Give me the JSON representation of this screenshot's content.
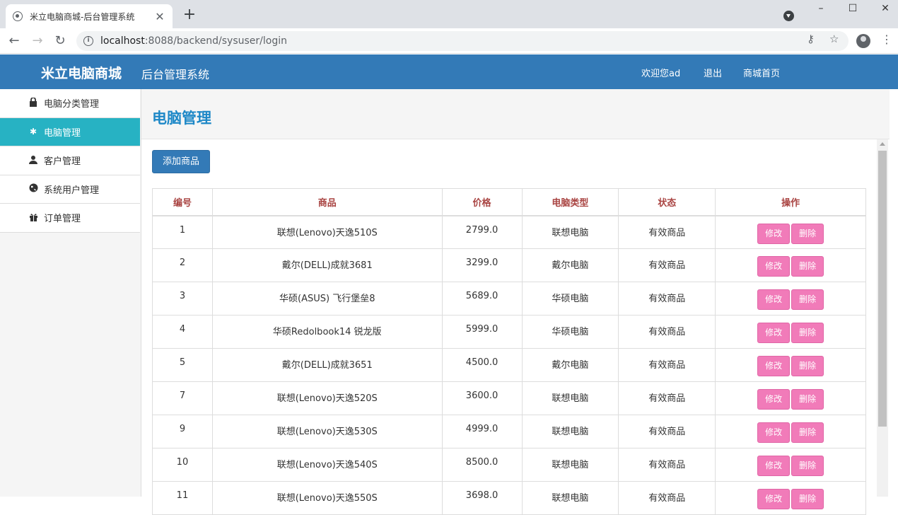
{
  "browser": {
    "tab_title": "米立电脑商城-后台管理系统",
    "url_host": "localhost",
    "url_path": ":8088/backend/sysuser/login"
  },
  "header": {
    "brand": "米立电脑商城",
    "subtitle": "后台管理系统",
    "welcome": "欢迎您ad",
    "logout": "退出",
    "home": "商城首页"
  },
  "sidebar": {
    "items": [
      {
        "label": "电脑分类管理",
        "icon": "lock-icon"
      },
      {
        "label": "电脑管理",
        "icon": "asterisk-icon",
        "active": true
      },
      {
        "label": "客户管理",
        "icon": "user-icon"
      },
      {
        "label": "系统用户管理",
        "icon": "globe-icon"
      },
      {
        "label": "订单管理",
        "icon": "gift-icon"
      }
    ]
  },
  "main": {
    "title": "电脑管理",
    "add_button": "添加商品"
  },
  "table": {
    "columns": [
      "编号",
      "商品",
      "价格",
      "电脑类型",
      "状态",
      "操作"
    ],
    "edit_label": "修改",
    "delete_label": "删除",
    "rows": [
      {
        "id": "1",
        "name": "联想(Lenovo)天逸510S",
        "price": "2799.0",
        "type": "联想电脑",
        "status": "有效商品"
      },
      {
        "id": "2",
        "name": "戴尔(DELL)成就3681",
        "price": "3299.0",
        "type": "戴尔电脑",
        "status": "有效商品"
      },
      {
        "id": "3",
        "name": "华硕(ASUS) 飞行堡垒8",
        "price": "5689.0",
        "type": "华硕电脑",
        "status": "有效商品"
      },
      {
        "id": "4",
        "name": "华硕Redolbook14 锐龙版",
        "price": "5999.0",
        "type": "华硕电脑",
        "status": "有效商品"
      },
      {
        "id": "5",
        "name": "戴尔(DELL)成就3651",
        "price": "4500.0",
        "type": "戴尔电脑",
        "status": "有效商品"
      },
      {
        "id": "7",
        "name": "联想(Lenovo)天逸520S",
        "price": "3600.0",
        "type": "联想电脑",
        "status": "有效商品"
      },
      {
        "id": "9",
        "name": "联想(Lenovo)天逸530S",
        "price": "4999.0",
        "type": "联想电脑",
        "status": "有效商品"
      },
      {
        "id": "10",
        "name": "联想(Lenovo)天逸540S",
        "price": "8500.0",
        "type": "联想电脑",
        "status": "有效商品"
      },
      {
        "id": "11",
        "name": "联想(Lenovo)天逸550S",
        "price": "3698.0",
        "type": "联想电脑",
        "status": "有效商品"
      }
    ]
  },
  "colors": {
    "header_bg": "#337ab7",
    "active_item": "#27b2c3",
    "op_button": "#f17bb9",
    "th_text": "#a94442",
    "title": "#1e88c7"
  }
}
